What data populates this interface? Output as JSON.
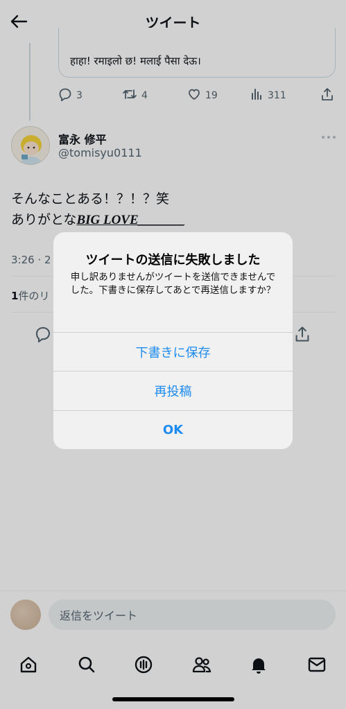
{
  "header": {
    "title": "ツイート"
  },
  "quoted_tweet": {
    "text": "हाहा! रमाइलो छ! मलाई पैसा देऊ।",
    "stats": {
      "replies": "3",
      "retweets": "4",
      "likes": "19",
      "views": "311"
    }
  },
  "tweet": {
    "author_name": "富永 修平",
    "author_handle": "@tomisyu0111",
    "text_line1": "そんなことある！？！？笑",
    "text_line2_prefix": "ありがとな",
    "text_line2_emphasis": "BIG LOVE_______",
    "timestamp": "3:26 · 2",
    "reply_count_num": "1",
    "reply_count_label": "件のリ"
  },
  "composer": {
    "placeholder": "返信をツイート"
  },
  "alert": {
    "title": "ツイートの送信に失敗しました",
    "message": "申し訳ありませんがツイートを送信できませんでした。下書きに保存してあとで再送信しますか？",
    "save_draft": "下書きに保存",
    "repost": "再投稿",
    "ok": "OK"
  },
  "colors": {
    "link_blue": "#1d8cf0",
    "muted": "#536471"
  },
  "icons": [
    "back-arrow-icon",
    "reply-icon",
    "retweet-icon",
    "like-icon",
    "views-icon",
    "share-icon",
    "more-icon",
    "home-icon",
    "search-icon",
    "spaces-icon",
    "communities-icon",
    "notifications-icon",
    "messages-icon"
  ]
}
